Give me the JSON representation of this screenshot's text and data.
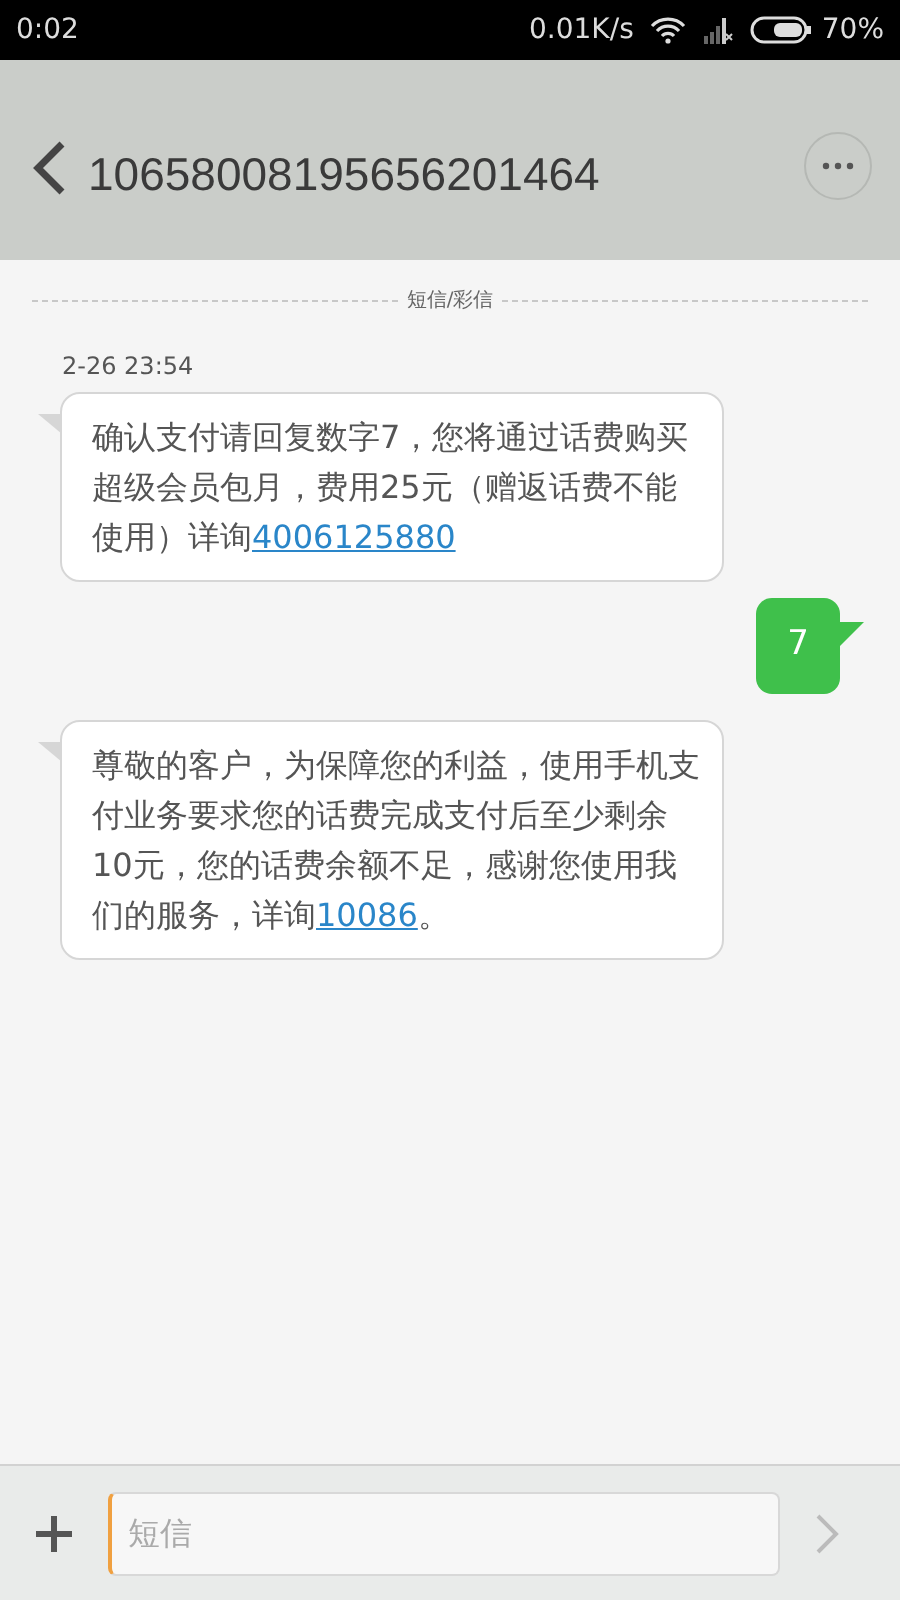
{
  "status_bar": {
    "time": "0:02",
    "speed": "0.01K/s",
    "battery": "70%"
  },
  "header": {
    "title": "10658008195656201464"
  },
  "channel_label": "短信/彩信",
  "messages": [
    {
      "kind": "incoming",
      "timestamp": "2-26 23:54",
      "parts": [
        {
          "kind": "text",
          "text": "确认支付请回复数字7，您将通过话费购买超级会员包月，费用25元（赠返话费不能使用）详询"
        },
        {
          "kind": "link",
          "text": "4006125880"
        }
      ]
    },
    {
      "kind": "outgoing",
      "parts": [
        {
          "kind": "text",
          "text": "7"
        }
      ]
    },
    {
      "kind": "incoming",
      "parts": [
        {
          "kind": "text",
          "text": "尊敬的客户，为保障您的利益，使用手机支付业务要求您的话费完成支付后至少剩余10元，您的话费余额不足，感谢您使用我们的服务，详询"
        },
        {
          "kind": "link",
          "text": "10086"
        },
        {
          "kind": "text",
          "text": "。"
        }
      ]
    }
  ],
  "composer": {
    "placeholder": "短信"
  }
}
